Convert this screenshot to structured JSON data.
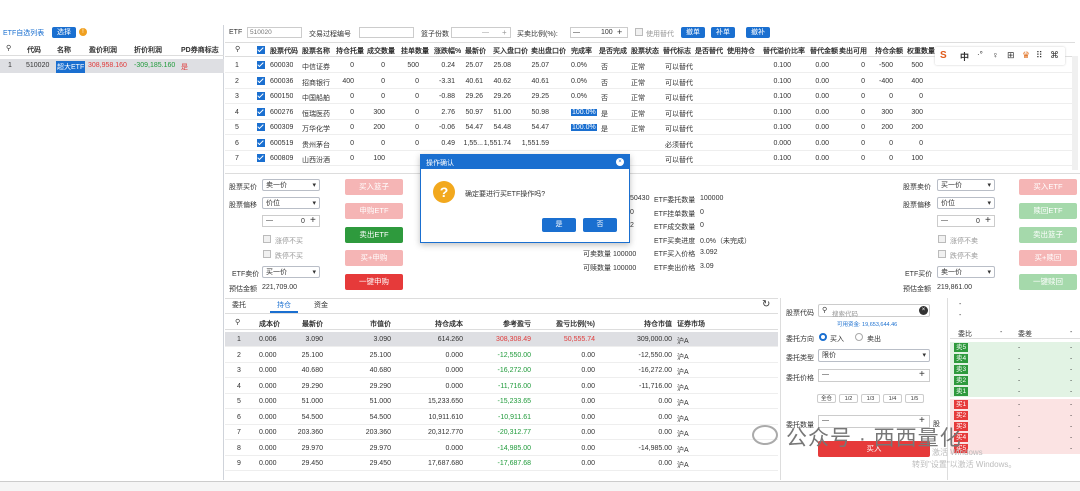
{
  "etf_panel": {
    "tab_label": "ETF自选列表",
    "select_label": "选择",
    "headers": [
      "代码",
      "名称",
      "盈价利润",
      "折价利润",
      "PD券商标志"
    ],
    "rows": [
      {
        "idx": "1",
        "code": "510020",
        "name": "超大ETF",
        "premium": "308,958.160",
        "discount": "-309,185.160",
        "flag": "是"
      }
    ]
  },
  "toolbar": {
    "etf_label": "ETF",
    "etf_placeholder": "510020",
    "trans_label": "交易过程编号",
    "basket_label": "篮子份数",
    "basket_value": "—",
    "basket_plus": "+",
    "ratio_label": "买卖比例(%):",
    "ratio_minus": "—",
    "ratio_value": "100",
    "ratio_plus": "+",
    "use_replace": "使用替代",
    "btn_cancel": "撤单",
    "btn_fill": "补单",
    "btn_refill": "撤补"
  },
  "stocks": {
    "headers": [
      "股票代码",
      "股票名称",
      "持仓托量",
      "成交数量",
      "挂单数量",
      "涨跌幅%",
      "最新价",
      "买入盘口价",
      "卖出盘口价",
      "完成率",
      "是否完成",
      "股票状态",
      "替代标志",
      "是否替代",
      "使用持仓",
      "替代溢价比率",
      "替代金额",
      "卖出可用",
      "持仓余额",
      "权重数量"
    ],
    "rows": [
      {
        "idx": "1",
        "code": "600030",
        "name": "中信证券",
        "hold": "0",
        "deal": "0",
        "pend": "500",
        "chg": "0.24",
        "last": "25.07",
        "bid": "25.08",
        "ask": "25.07",
        "rate": "0.0%",
        "done": "否",
        "status": "正常",
        "rep": "可以替代",
        "pct": "0.100",
        "amt": "0.00",
        "avail": "0",
        "bal": "-500",
        "wt": "500"
      },
      {
        "idx": "2",
        "code": "600036",
        "name": "招商银行",
        "hold": "400",
        "deal": "0",
        "pend": "0",
        "chg": "-3.31",
        "last": "40.61",
        "bid": "40.62",
        "ask": "40.61",
        "rate": "0.0%",
        "done": "否",
        "status": "正常",
        "rep": "可以替代",
        "pct": "0.100",
        "amt": "0.00",
        "avail": "0",
        "bal": "-400",
        "wt": "400"
      },
      {
        "idx": "3",
        "code": "600150",
        "name": "中国船舶",
        "hold": "0",
        "deal": "0",
        "pend": "0",
        "chg": "-0.88",
        "last": "29.26",
        "bid": "29.26",
        "ask": "29.25",
        "rate": "0.0%",
        "done": "否",
        "status": "正常",
        "rep": "可以替代",
        "pct": "0.100",
        "amt": "0.00",
        "avail": "0",
        "bal": "0",
        "wt": "0"
      },
      {
        "idx": "4",
        "code": "600276",
        "name": "恒瑞医药",
        "hold": "0",
        "deal": "300",
        "pend": "0",
        "chg": "2.76",
        "last": "50.97",
        "bid": "51.00",
        "ask": "50.98",
        "rate": "100.0%",
        "done": "是",
        "status": "正常",
        "rep": "可以替代",
        "pct": "0.100",
        "amt": "0.00",
        "avail": "0",
        "bal": "300",
        "wt": "300"
      },
      {
        "idx": "5",
        "code": "600309",
        "name": "万华化学",
        "hold": "0",
        "deal": "200",
        "pend": "0",
        "chg": "-0.06",
        "last": "54.47",
        "bid": "54.48",
        "ask": "54.47",
        "rate": "100.0%",
        "done": "是",
        "status": "正常",
        "rep": "可以替代",
        "pct": "0.100",
        "amt": "0.00",
        "avail": "0",
        "bal": "200",
        "wt": "200"
      },
      {
        "idx": "6",
        "code": "600519",
        "name": "贵州茅台",
        "hold": "0",
        "deal": "0",
        "pend": "0",
        "chg": "0.49",
        "last": "1,55...",
        "bid": "1,551.74",
        "ask": "1,551.59",
        "rate": "",
        "done": "",
        "status": "",
        "rep": "必须替代",
        "pct": "0.000",
        "amt": "0.00",
        "avail": "0",
        "bal": "0",
        "wt": "0"
      },
      {
        "idx": "7",
        "code": "600809",
        "name": "山西汾酒",
        "hold": "0",
        "deal": "100",
        "pend": "",
        "chg": "",
        "last": "",
        "bid": "",
        "ask": "",
        "rate": "",
        "done": "",
        "status": "",
        "rep": "可以替代",
        "pct": "0.100",
        "amt": "0.00",
        "avail": "0",
        "bal": "0",
        "wt": "100"
      }
    ]
  },
  "sys_icons": [
    "S",
    "中",
    "·°",
    "♀",
    "⊞",
    "♛",
    "⠿",
    "⌘"
  ],
  "order_left": {
    "stock_buy_price_label": "股票买价",
    "stock_buy_price_value": "卖一价",
    "stock_offset_label": "股票偏移",
    "stock_offset_value": "价位",
    "offset_minus": "—",
    "offset_value": "0",
    "offset_plus": "+",
    "chk_no_buy": "涨停不买",
    "chk_no_sell": "跌停不买",
    "etf_sell_label": "ETF卖价",
    "etf_sell_value": "买一价",
    "est_amount_label": "预估金额",
    "est_amount_value": "221,709.00",
    "btn_buy_basket": "买入篮子",
    "btn_redeem": "申购ETF",
    "btn_sell_etf": "卖出ETF",
    "btn_buy_redeem": "买+申购",
    "btn_onekey": "一键申购"
  },
  "order_mid": {
    "items": [
      {
        "a": "50430",
        "b": "ETF委托数量",
        "c": "100000"
      },
      {
        "a": "0",
        "b": "ETF挂单数量",
        "c": "0"
      },
      {
        "a": "2",
        "b": "ETF成交数量",
        "c": "0"
      },
      {
        "a": "",
        "b": "ETF买卖进度",
        "c": "0.0%（未完成）"
      },
      {
        "a": "可卖数量 100000",
        "b": "ETF买入价格",
        "c": "3.092"
      },
      {
        "a": "可赎数量 100000",
        "b": "ETF卖出价格",
        "c": "3.09"
      }
    ]
  },
  "order_right": {
    "stock_sell_price_label": "股票卖价",
    "stock_sell_price_value": "买一价",
    "stock_offset_label": "股票偏移",
    "stock_offset_value": "价位",
    "offset_minus": "—",
    "offset_value": "0",
    "offset_plus": "+",
    "chk_no_sell": "涨停不卖",
    "chk_no_sell2": "跌停不卖",
    "etf_buy_label": "ETF买价",
    "etf_buy_value": "卖一价",
    "est_amount_label": "预估金额",
    "est_amount_value": "219,861.00",
    "btn_buy_etf": "买入ETF",
    "btn_redeem_etf": "赎回ETF",
    "btn_sell_basket": "卖出篮子",
    "btn_sell_redeem": "买+赎回",
    "btn_onekey": "一键赎回"
  },
  "dialog": {
    "title": "操作确认",
    "message": "确定要进行买ETF操作吗?",
    "yes": "是",
    "no": "否"
  },
  "positions": {
    "tabs": [
      "委托",
      "持仓",
      "资金"
    ],
    "headers": [
      "成本价",
      "最新价",
      "市值价",
      "持仓成本",
      "参考盈亏",
      "盈亏比例(%)",
      "持仓市值",
      "证券市场"
    ],
    "rows": [
      {
        "idx": "1",
        "cost": "0.006",
        "last": "3.090",
        "mv": "3.090",
        "hc": "614.260",
        "pl": "308,308.49",
        "pr": "50,555.74",
        "hm": "309,000.00",
        "mk": "沪A"
      },
      {
        "idx": "2",
        "cost": "0.000",
        "last": "25.100",
        "mv": "25.100",
        "hc": "0.000",
        "pl": "-12,550.00",
        "pr": "0.00",
        "hm": "-12,550.00",
        "mk": "沪A"
      },
      {
        "idx": "3",
        "cost": "0.000",
        "last": "40.680",
        "mv": "40.680",
        "hc": "0.000",
        "pl": "-16,272.00",
        "pr": "0.00",
        "hm": "-16,272.00",
        "mk": "沪A"
      },
      {
        "idx": "4",
        "cost": "0.000",
        "last": "29.290",
        "mv": "29.290",
        "hc": "0.000",
        "pl": "-11,716.00",
        "pr": "0.00",
        "hm": "-11,716.00",
        "mk": "沪A"
      },
      {
        "idx": "5",
        "cost": "0.000",
        "last": "51.000",
        "mv": "51.000",
        "hc": "15,233.650",
        "pl": "-15,233.65",
        "pr": "0.00",
        "hm": "0.00",
        "mk": "沪A"
      },
      {
        "idx": "6",
        "cost": "0.000",
        "last": "54.500",
        "mv": "54.500",
        "hc": "10,911.610",
        "pl": "-10,911.61",
        "pr": "0.00",
        "hm": "0.00",
        "mk": "沪A"
      },
      {
        "idx": "7",
        "cost": "0.000",
        "last": "203.360",
        "mv": "203.360",
        "hc": "20,312.770",
        "pl": "-20,312.77",
        "pr": "0.00",
        "hm": "0.00",
        "mk": "沪A"
      },
      {
        "idx": "8",
        "cost": "0.000",
        "last": "29.970",
        "mv": "29.970",
        "hc": "0.000",
        "pl": "-14,985.00",
        "pr": "0.00",
        "hm": "-14,985.00",
        "mk": "沪A"
      },
      {
        "idx": "9",
        "cost": "0.000",
        "last": "29.450",
        "mv": "29.450",
        "hc": "17,687.680",
        "pl": "-17,687.68",
        "pr": "0.00",
        "hm": "0.00",
        "mk": "沪A"
      }
    ]
  },
  "trade_form": {
    "code_label": "股票代码",
    "code_placeholder": "搜索代码",
    "avail_funds": "可用资金: 19,653,644.46",
    "dir_label": "委托方向",
    "dir_buy": "买入",
    "dir_sell": "卖出",
    "type_label": "委托类型",
    "type_value": "限价",
    "price_label": "委托价格",
    "price_minus": "—",
    "price_plus": "+",
    "fractions": [
      "全仓",
      "1/2",
      "1/3",
      "1/4",
      "1/5"
    ],
    "qty_label": "委托数量",
    "qty_minus": "—",
    "qty_plus": "+",
    "qty_unit": "股",
    "submit": "买入"
  },
  "orderbook": {
    "headers": [
      "委比",
      "-",
      "委差",
      "-"
    ],
    "top": [
      "-",
      "-"
    ],
    "sells": [
      "卖5",
      "卖4",
      "卖3",
      "卖2",
      "卖1"
    ],
    "buys": [
      "买1",
      "买2",
      "买3",
      "买4",
      "买5"
    ],
    "placeholder": "-"
  },
  "watermark": {
    "main": "公众号 · 西西量化",
    "sub": "转到\"设置\"以激活 Windows。",
    "act": "激活 Windows"
  }
}
